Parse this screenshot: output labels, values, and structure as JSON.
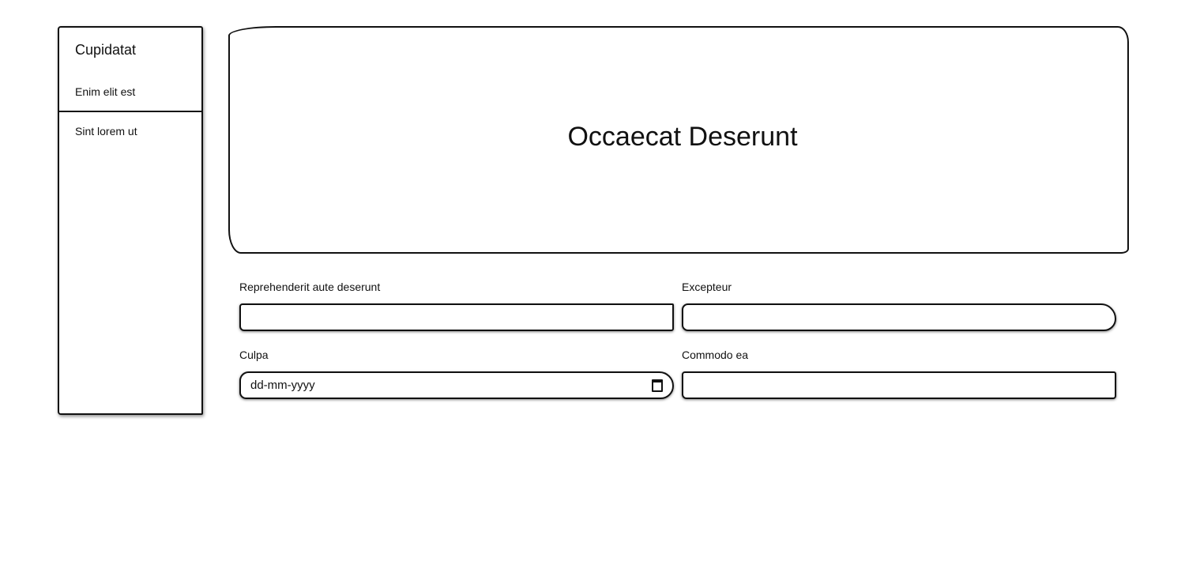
{
  "sidebar": {
    "title": "Cupidatat",
    "items": [
      {
        "label": "Enim elit est"
      },
      {
        "label": "Sint lorem ut"
      }
    ]
  },
  "hero": {
    "title": "Occaecat Deserunt"
  },
  "form": {
    "fields": [
      {
        "label": "Reprehenderit aute deserunt",
        "type": "text",
        "value": ""
      },
      {
        "label": "Excepteur",
        "type": "text",
        "value": ""
      },
      {
        "label": "Culpa",
        "type": "date",
        "placeholder": "dd-mm-yyyy",
        "icon": "calendar-icon"
      },
      {
        "label": "Commodo ea",
        "type": "text",
        "value": ""
      }
    ]
  }
}
